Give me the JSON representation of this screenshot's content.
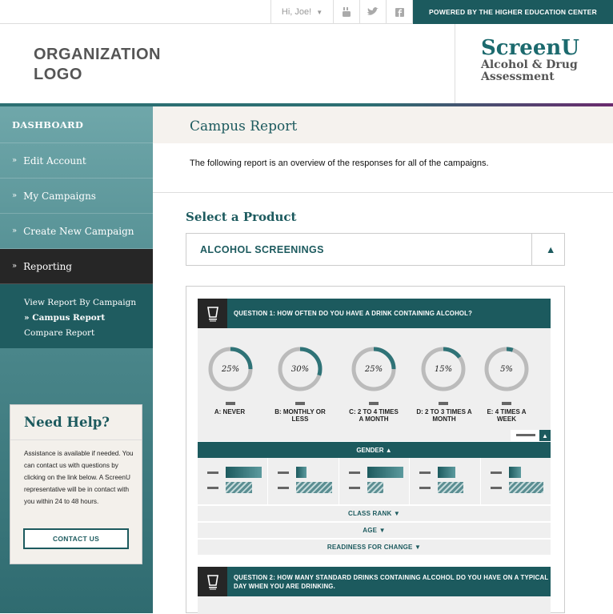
{
  "topbar": {
    "greeting": "Hi, Joe!",
    "powered_by": "POWERED BY THE HIGHER EDUCATION CENTER"
  },
  "header": {
    "org_logo_line1": "ORGANIZATION",
    "org_logo_line2": "LOGO",
    "brand_name": "ScreenU",
    "brand_sub1": "Alcohol & Drug",
    "brand_sub2": "Assessment"
  },
  "sidebar": {
    "dashboard": "DASHBOARD",
    "items": [
      {
        "label": "Edit Account"
      },
      {
        "label": "My Campaigns"
      },
      {
        "label": "Create New Campaign"
      },
      {
        "label": "Reporting"
      }
    ],
    "subitems": [
      {
        "label": "View Report By Campaign"
      },
      {
        "label": "Campus Report"
      },
      {
        "label": "Compare Report"
      }
    ]
  },
  "help": {
    "title": "Need Help?",
    "body": "Assistance is available if needed. You can contact us with questions by clicking on the link below. A ScreenU representative will be in contact with you within 24 to 48 hours.",
    "button": "CONTACT US"
  },
  "main": {
    "title": "Campus Report",
    "intro": "The following report is an overview of the responses for all of the campaigns.",
    "select_heading": "Select a Product",
    "product": "ALCOHOL SCREENINGS"
  },
  "question1": {
    "text": "QUESTION 1: HOW OFTEN DO YOU HAVE A DRINK CONTAINING ALCOHOL?",
    "answers": [
      {
        "pct": "25%",
        "value": 25,
        "label1": "A: NEVER",
        "label2": ""
      },
      {
        "pct": "30%",
        "value": 30,
        "label1": "B: MONTHLY OR",
        "label2": "LESS"
      },
      {
        "pct": "25%",
        "value": 25,
        "label1": "C: 2 TO 4 TIMES",
        "label2": "A MONTH"
      },
      {
        "pct": "15%",
        "value": 15,
        "label1": "D: 2 TO 3 TIMES A",
        "label2": "MONTH"
      },
      {
        "pct": "5%",
        "value": 5,
        "label1": "E: 4 TIMES A",
        "label2": "WEEK"
      }
    ]
  },
  "filters": {
    "gender": "GENDER ▲",
    "class_rank": "CLASS RANK ▼",
    "age": "AGE ▼",
    "readiness": "READINESS FOR CHANGE ▼"
  },
  "question2": {
    "text": "QUESTION 2: HOW MANY STANDARD DRINKS CONTAINING ALCOHOL DO YOU HAVE ON A TYPICAL DAY WHEN YOU ARE DRINKING."
  },
  "colors": {
    "teal": "#1c5a5e",
    "dark": "#262626",
    "ring_bg": "#bbbbbb",
    "ring_fg": "#2f7377"
  }
}
